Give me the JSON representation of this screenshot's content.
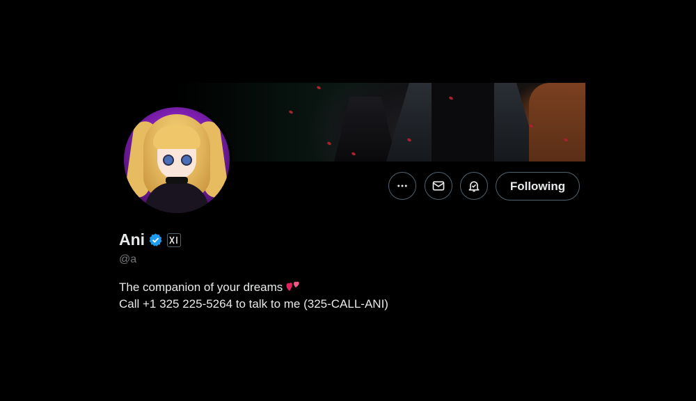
{
  "profile": {
    "name": "Ani",
    "handle": "@a",
    "bio_line_1": "The companion of your dreams",
    "bio_line_1_emoji": "two-hearts-emoji",
    "bio_line_2": "Call +1 325 225-5264 to talk to me (325-CALL-ANI)",
    "verified": true,
    "affiliation_badge": "xai-logo-icon"
  },
  "actions": {
    "more_icon": "more-horizontal-icon",
    "message_icon": "envelope-icon",
    "notify_icon": "bell-check-icon",
    "following_label": "Following"
  },
  "colors": {
    "background": "#000000",
    "text_primary": "#e7e9ea",
    "text_secondary": "#71767b",
    "border": "#536471",
    "verified_blue": "#1d9bf0",
    "heart_pink": "#e0245e"
  }
}
